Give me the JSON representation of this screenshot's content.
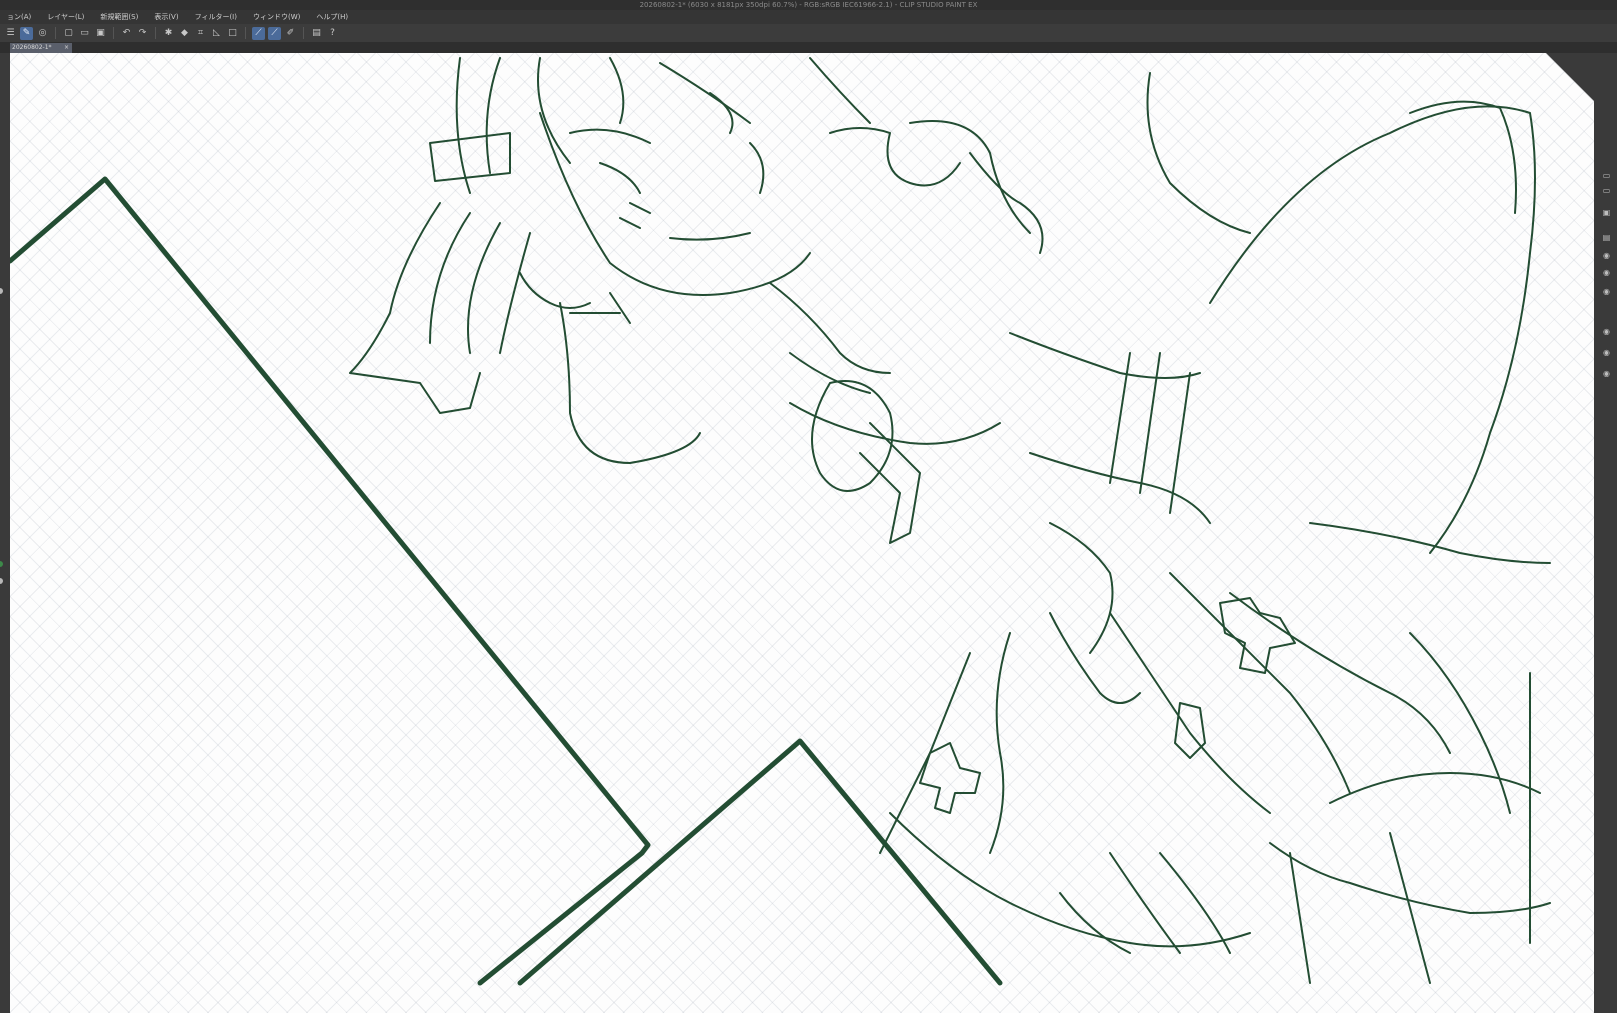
{
  "window": {
    "title": "20260802-1* (6030 x 8181px 350dpi 60.7%) - RGB:sRGB IEC61966-2.1) - CLIP STUDIO PAINT EX"
  },
  "menu": {
    "items": [
      "ョン(A)",
      "レイヤー(L)",
      "新規範囲(S)",
      "表示(V)",
      "フィルター(I)",
      "ウィンドウ(W)",
      "ヘルプ(H)"
    ]
  },
  "toolbar": {
    "icons": [
      "menu-icon",
      "brush-icon",
      "palette-icon",
      "new-document-icon",
      "open-folder-icon",
      "save-icon",
      "undo-icon",
      "redo-icon",
      "settings-icon",
      "fill-icon",
      "transform-icon",
      "ruler-icon",
      "select-icon",
      "pen-icon",
      "line-icon",
      "edit-icon",
      "layer-icon",
      "help-icon"
    ],
    "active": [
      "pen-icon",
      "line-icon"
    ]
  },
  "document_tab": {
    "label": "20260802-1*",
    "close": "×"
  },
  "colors": {
    "stroke": "#234d33",
    "canvas": "#fdfdfd",
    "chrome": "#3a3a3a"
  }
}
